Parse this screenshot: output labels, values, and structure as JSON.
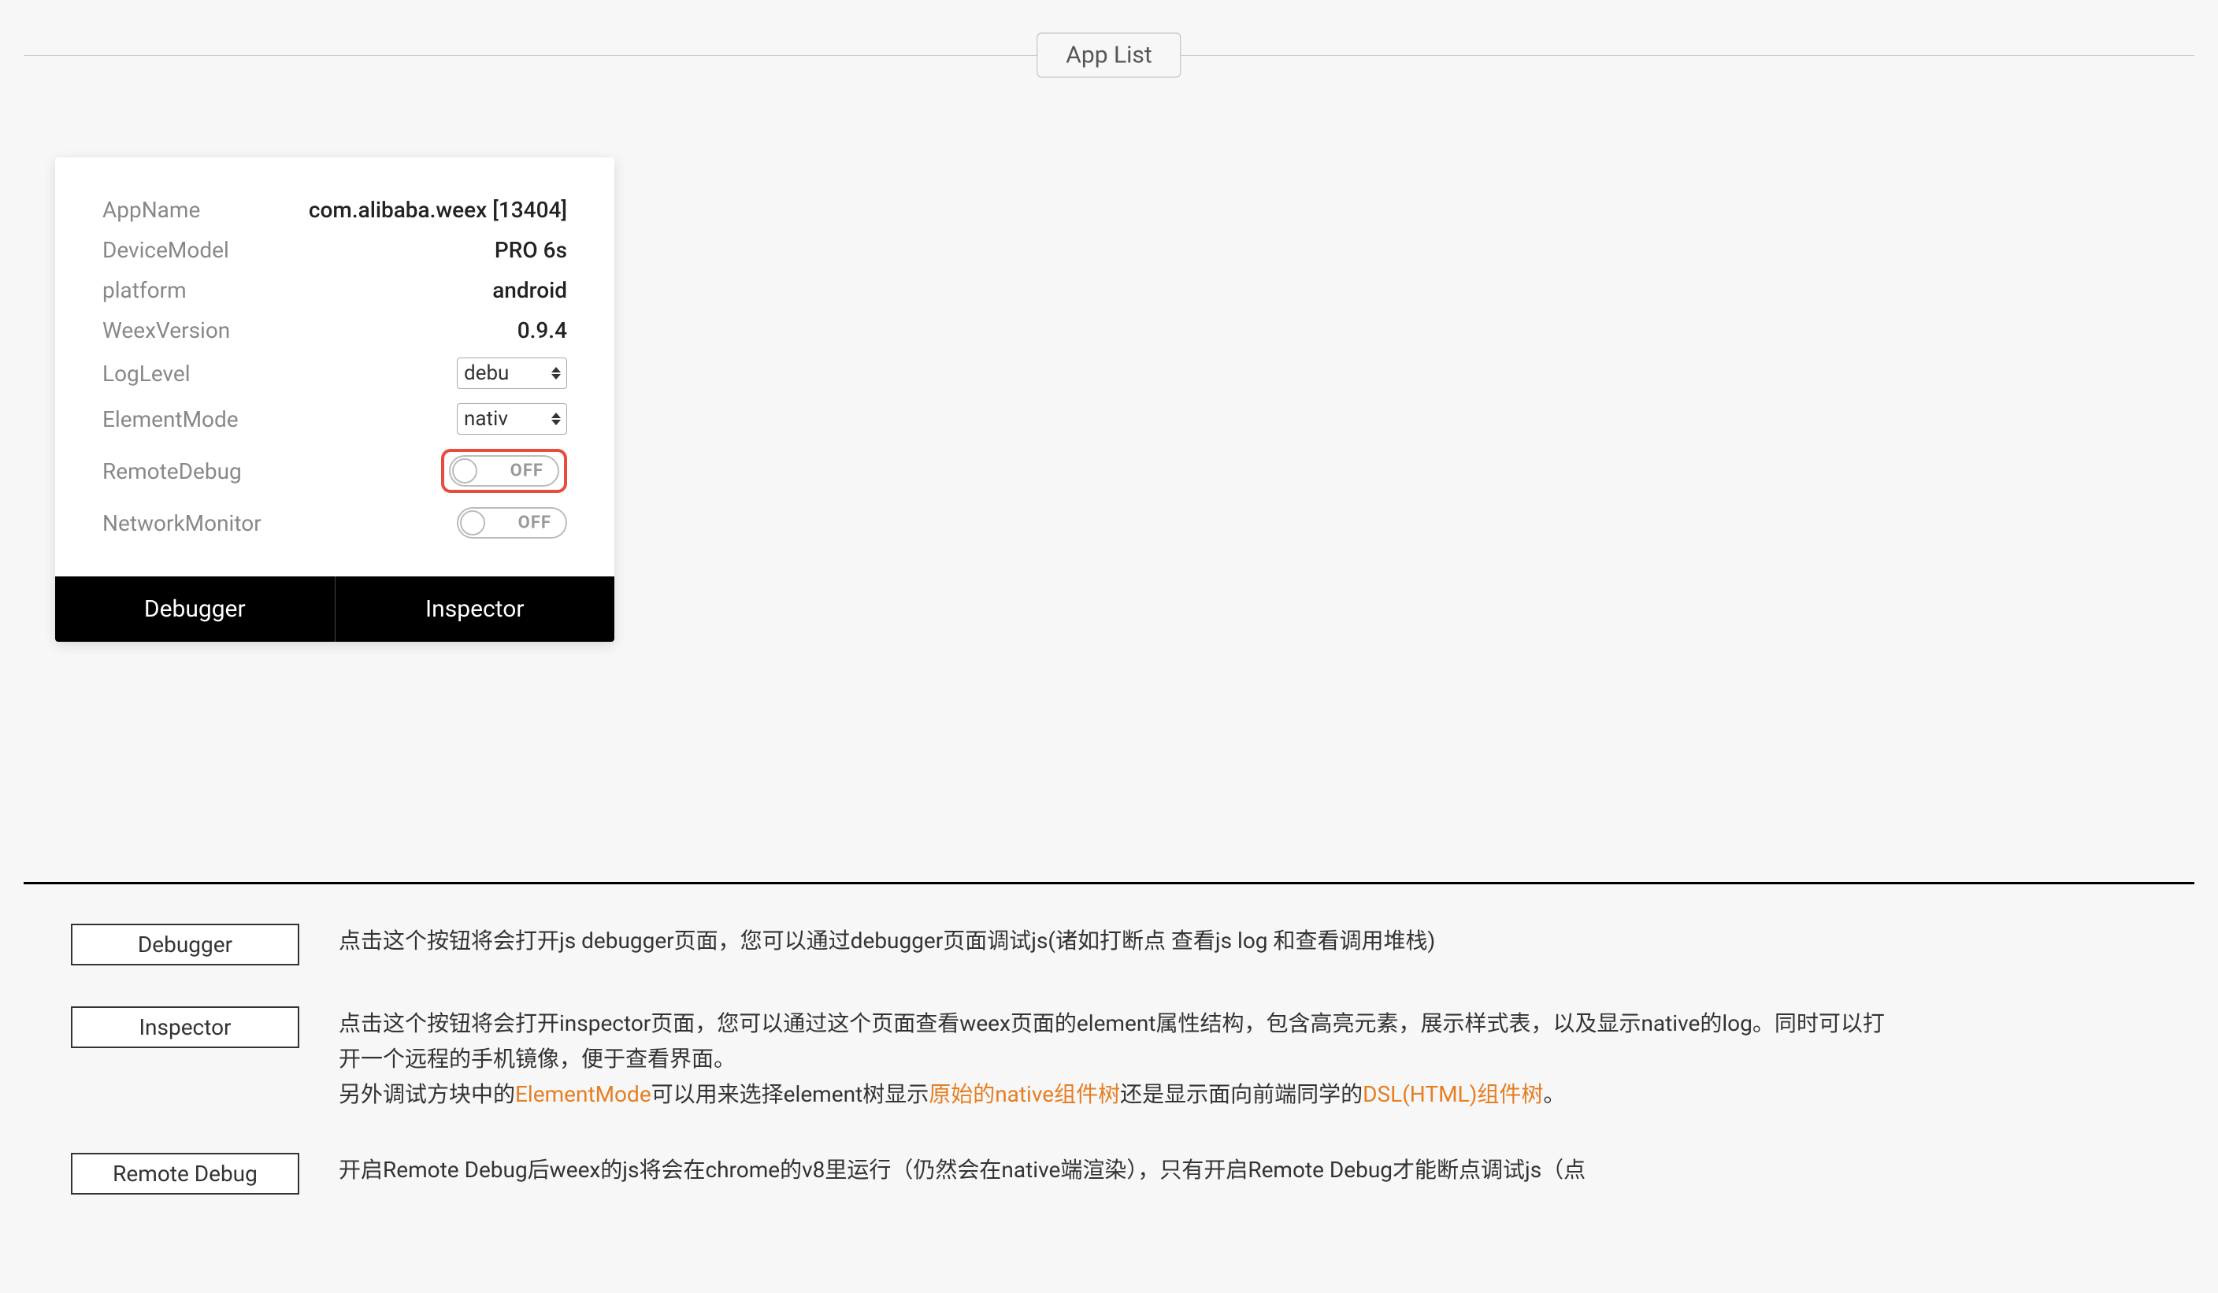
{
  "header": {
    "title": "App List"
  },
  "card": {
    "rows": {
      "appName": {
        "label": "AppName",
        "value": "com.alibaba.weex [13404]"
      },
      "deviceModel": {
        "label": "DeviceModel",
        "value": "PRO 6s"
      },
      "platform": {
        "label": "platform",
        "value": "android"
      },
      "weexVersion": {
        "label": "WeexVersion",
        "value": "0.9.4"
      }
    },
    "controls": {
      "logLevel": {
        "label": "LogLevel",
        "selected": "debu"
      },
      "elementMode": {
        "label": "ElementMode",
        "selected": "nativ"
      },
      "remoteDebug": {
        "label": "RemoteDebug",
        "state": "OFF"
      },
      "networkMonitor": {
        "label": "NetworkMonitor",
        "state": "OFF"
      }
    },
    "footer": {
      "debugger": "Debugger",
      "inspector": "Inspector"
    }
  },
  "docs": {
    "debugger": {
      "button": "Debugger",
      "text": "点击这个按钮将会打开js debugger页面，您可以通过debugger页面调试js(诸如打断点 查看js log 和查看调用堆栈)"
    },
    "inspector": {
      "button": "Inspector",
      "line1": "点击这个按钮将会打开inspector页面，您可以通过这个页面查看weex页面的element属性结构，包含高亮元素，展示样式表，以及显示native的log。同时可以打开一个远程的手机镜像，便于查看界面。",
      "line2_a": "另外调试方块中的",
      "line2_link1": "ElementMode",
      "line2_b": "可以用来选择element树显示",
      "line2_link2": "原始的native组件树",
      "line2_c": "还是显示面向前端同学的",
      "line2_link3": "DSL(HTML)组件树",
      "line2_d": "。"
    },
    "remoteDebug": {
      "button": "Remote Debug",
      "text": "开启Remote Debug后weex的js将会在chrome的v8里运行（仍然会在native端渲染），只有开启Remote Debug才能断点调试js（点"
    }
  }
}
